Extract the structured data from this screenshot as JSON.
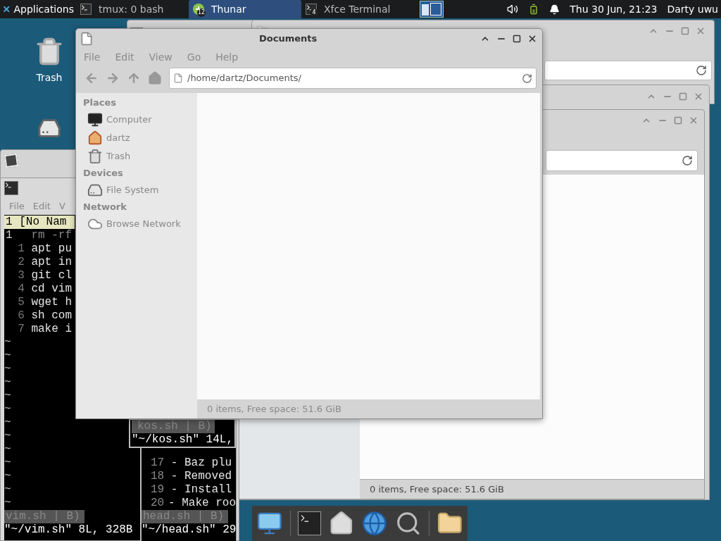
{
  "panel": {
    "apps_label": "Applications",
    "tasks": [
      {
        "kind": "terminal",
        "label": "tmux: 0 bash",
        "selected": false
      },
      {
        "kind": "files",
        "label": "Thunar",
        "badge": "12",
        "selected": true
      },
      {
        "kind": "terminal",
        "label": "Xfce Terminal",
        "badge": "4",
        "selected": false
      }
    ],
    "clock": "Thu 30 Jun, 21:23",
    "user": "Darty uwu"
  },
  "desktop_icons": [
    {
      "kind": "trash",
      "label": "Trash"
    },
    {
      "kind": "drive"
    }
  ],
  "documents_window": {
    "title": "Documents",
    "menu": [
      "File",
      "Edit",
      "View",
      "Go",
      "Help"
    ],
    "path": "/home/dartz/Documents/",
    "sidebar": [
      {
        "heading": "Places",
        "items": [
          {
            "kind": "computer",
            "label": "Computer"
          },
          {
            "kind": "home",
            "label": "dartz"
          },
          {
            "kind": "trash",
            "label": "Trash"
          }
        ]
      },
      {
        "heading": "Devices",
        "items": [
          {
            "kind": "drive",
            "label": "File System"
          }
        ]
      },
      {
        "heading": "Network",
        "items": [
          {
            "kind": "network",
            "label": "Browse Network"
          }
        ]
      }
    ],
    "status": "0 items, Free space: 51.6 GiB"
  },
  "back_window": {
    "status": "0 items, Free space: 51.6 GiB"
  },
  "terminal": {
    "menu": [
      "File",
      "Edit",
      "V"
    ],
    "tab_line": "1 [No Nam",
    "lines": [
      {
        "number": "1",
        "text": "rm -rf",
        "current": true
      },
      {
        "number": "1",
        "text": "apt pu",
        "current": false
      },
      {
        "number": "2",
        "text": "apt in",
        "current": false
      },
      {
        "number": "3",
        "text": "git cl",
        "current": false
      },
      {
        "number": "4",
        "text": "cd vim",
        "current": false
      },
      {
        "number": "5",
        "text": "wget h",
        "current": false
      },
      {
        "number": "6",
        "text": "sh com",
        "current": false
      },
      {
        "number": "7",
        "text": "make i",
        "current": false
      }
    ],
    "tildes": [
      "~",
      "~",
      "~",
      "~",
      "~",
      "~",
      "~",
      "~",
      "~",
      "~",
      "~",
      "~",
      "~"
    ],
    "status": "vim.sh | B)",
    "message": "\"~/vim.sh\" 8L, 328B"
  },
  "kos_pane": {
    "status": "kos.sh | B)",
    "message": "\"~/kos.sh\" 14L,"
  },
  "head_pane": {
    "lines": [
      {
        "number": "17",
        "text": "- Baz plu"
      },
      {
        "number": "18",
        "text": "- Removed"
      },
      {
        "number": "19",
        "text": "- Install"
      },
      {
        "number": "20",
        "text": "- Make roo"
      }
    ],
    "status": "head.sh | B)",
    "message": "\"~/head.sh\" 29"
  }
}
